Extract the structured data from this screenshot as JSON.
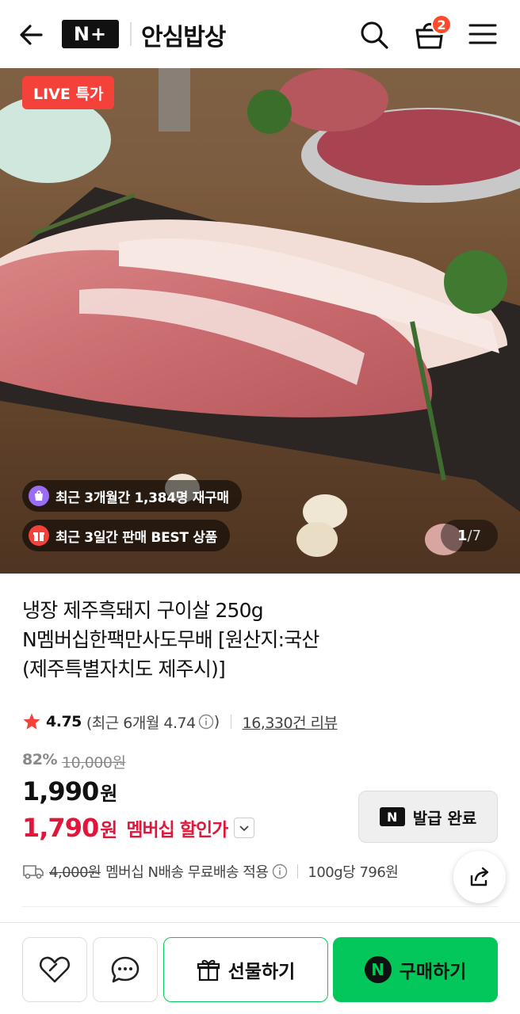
{
  "header": {
    "logo_text": "N+",
    "store_name": "안심밥상",
    "cart_count": "2"
  },
  "hero": {
    "live_badge": "LIVE 특가",
    "chips": [
      {
        "text": "최근 3개월간 1,384명 재구매",
        "icon": "shopping-bag-icon",
        "color": "#9b6cf5"
      },
      {
        "text": "최근 3일간 판매 BEST 상품",
        "icon": "gift-icon",
        "color": "#f4423b"
      }
    ],
    "counter_current": "1",
    "counter_total": "/7"
  },
  "product": {
    "title_lines": [
      "냉장 제주흑돼지 구이살 250g",
      "N멤버십한팩만사도무배 [원산지:국산",
      "(제주특별자치도 제주시)]"
    ],
    "rating": "4.75",
    "rating_sub": "(최근 6개월 4.74",
    "rating_sub_close": ")",
    "reviews": "16,330건 리뷰",
    "discount_pct": "82%",
    "original_price": "10,000원",
    "price": "1,990",
    "price_unit": "원",
    "member_price": "1,790",
    "member_price_unit": "원",
    "member_label": "멤버십 할인가",
    "coupon_label": "발급 완료"
  },
  "shipping": {
    "orig_fee": "4,000원",
    "text": "멤버십 N배송 무료배송 적용",
    "unit_price": "100g당 796원"
  },
  "bottom": {
    "gift_label": "선물하기",
    "buy_label": "구매하기",
    "buy_icon_text": "N",
    "accent": "#03c75a"
  }
}
